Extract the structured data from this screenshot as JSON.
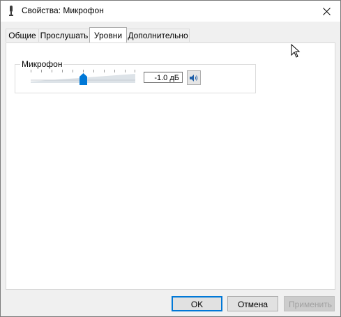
{
  "window": {
    "title": "Свойства: Микрофон"
  },
  "tabs": [
    {
      "label": "Общие",
      "active": false
    },
    {
      "label": "Прослушать",
      "active": false
    },
    {
      "label": "Уровни",
      "active": true
    },
    {
      "label": "Дополнительно",
      "active": false
    }
  ],
  "levels": {
    "group_label": "Микрофон",
    "slider_level_fraction": 0.5,
    "value": "-1.0 дБ",
    "mute_icon": "speaker-icon"
  },
  "buttons": {
    "ok": "OK",
    "cancel": "Отмена",
    "apply": "Применить"
  },
  "colors": {
    "accent": "#0078d7",
    "thumb": "#0078d7",
    "ramp": "#dde3e8"
  }
}
